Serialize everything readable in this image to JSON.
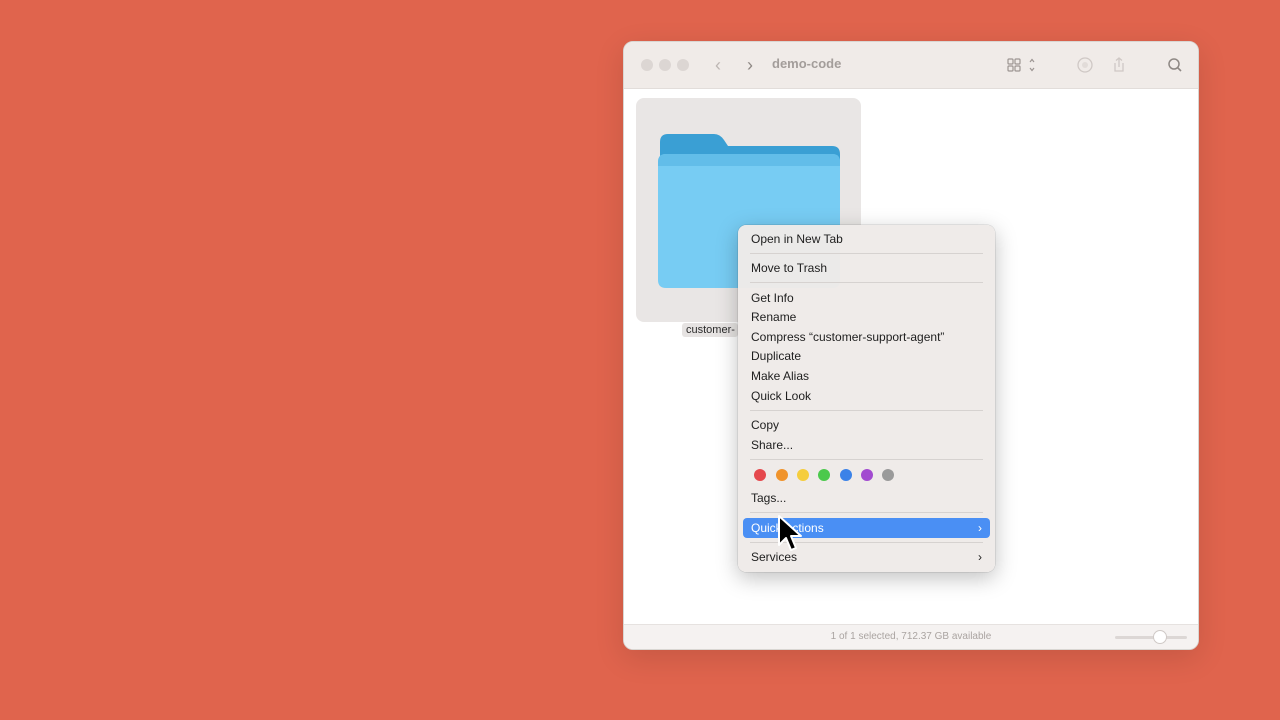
{
  "window": {
    "title": "demo-code",
    "status_text": "1 of 1 selected, 712.37 GB available",
    "icons": [
      "back-icon",
      "forward-icon",
      "grid-view-icon",
      "action-icon",
      "share-icon",
      "search-icon"
    ]
  },
  "file": {
    "name": "customer-",
    "icon": "folder-icon"
  },
  "context_menu": {
    "items": [
      {
        "label": "Open in New Tab"
      },
      {
        "label": "Move to Trash"
      },
      {
        "label": "Get Info"
      },
      {
        "label": "Rename"
      },
      {
        "label": "Compress “customer-support-agent”"
      },
      {
        "label": "Duplicate"
      },
      {
        "label": "Make Alias"
      },
      {
        "label": "Quick Look"
      },
      {
        "label": "Copy"
      },
      {
        "label": "Share..."
      },
      {
        "label": "Tags..."
      },
      {
        "label": "Quick Actions",
        "highlighted": true,
        "submenu": true
      },
      {
        "label": "Services",
        "submenu": true
      }
    ],
    "tag_colors": [
      "#e5484d",
      "#f0932b",
      "#f5cd3c",
      "#4cc94c",
      "#3b82e8",
      "#a24bd0",
      "#9a9a9a"
    ],
    "highlight_color": "#4a8ff4"
  },
  "colors": {
    "background": "#e0644d",
    "folder": "#6ec6f0"
  }
}
